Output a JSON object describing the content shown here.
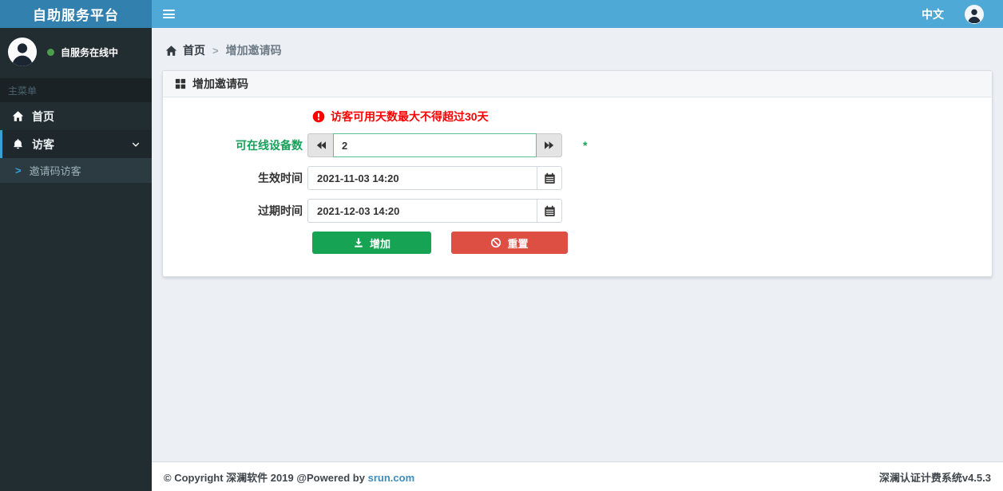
{
  "header": {
    "brand": "自助服务平台",
    "language": "中文"
  },
  "sidebar": {
    "user_status": "自服务在线中",
    "section_label": "主菜单",
    "items": [
      {
        "label": "首页",
        "icon": "home-icon",
        "active": false
      },
      {
        "label": "访客",
        "icon": "bell-icon",
        "active": true,
        "expanded": true,
        "children": [
          {
            "label": "邀请码访客",
            "active": true
          }
        ]
      }
    ]
  },
  "breadcrumb": {
    "home": "首页",
    "current": "增加邀请码"
  },
  "panel": {
    "title": "增加邀请码",
    "title_icon": "grid-icon",
    "error_message": "访客可用天数最大不得超过30天",
    "error_icon": "exclamation-circle-icon",
    "fields": [
      {
        "label": "可在线设备数",
        "value": "2",
        "required": "*"
      },
      {
        "label": "生效时间",
        "value": "2021-11-03 14:20"
      },
      {
        "label": "过期时间",
        "value": "2021-12-03 14:20"
      }
    ],
    "buttons": {
      "add": "增加",
      "reset": "重置"
    }
  },
  "footer": {
    "copyright_prefix": "© Copyright 深澜软件 2019 @Powered by",
    "link": "srun.com",
    "version": "深澜认证计费系统v4.5.3"
  },
  "icons": {
    "breadcrumb_separator": ">",
    "submenu_arrow": ">"
  },
  "colors": {
    "navbar_blue": "#4fa9d6",
    "logo_blue": "#3180ae",
    "sidebar_dark": "#222d32",
    "submenu_dark": "#2c3b41",
    "active_border_blue": "#3c9dd0",
    "content_bg": "#ecf0f5",
    "success_green": "#17a354",
    "danger_red": "#dd4f43",
    "error_red": "#fd0000",
    "label_green": "#18a05a",
    "input_green_border": "#5cc193",
    "link_blue": "#3c8dbc",
    "online_dot_green": "#4b9e4b"
  }
}
